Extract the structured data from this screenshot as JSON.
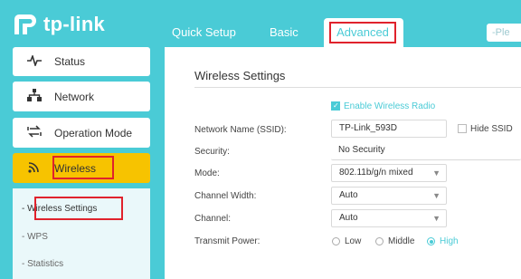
{
  "brand": {
    "logo_text": "tp-link"
  },
  "top_nav": {
    "quick_setup": "Quick Setup",
    "basic": "Basic",
    "advanced": "Advanced",
    "search_placeholder": "-Ple"
  },
  "sidebar": {
    "items": [
      {
        "label": "Status",
        "icon": "pulse-icon"
      },
      {
        "label": "Network",
        "icon": "network-icon"
      },
      {
        "label": "Operation Mode",
        "icon": "swap-icon"
      },
      {
        "label": "Wireless",
        "icon": "wifi-icon"
      }
    ],
    "submenu": [
      {
        "label": "- Wireless Settings"
      },
      {
        "label": "- WPS"
      },
      {
        "label": "- Statistics"
      }
    ]
  },
  "main": {
    "title": "Wireless Settings",
    "enable_radio_label": "Enable Wireless Radio",
    "enable_radio_checked": true,
    "rows": {
      "ssid_label": "Network Name (SSID):",
      "ssid_value": "TP-Link_593D",
      "hide_ssid_label": "Hide SSID",
      "security_label": "Security:",
      "security_value": "No Security",
      "mode_label": "Mode:",
      "mode_value": "802.11b/g/n mixed",
      "channel_width_label": "Channel Width:",
      "channel_width_value": "Auto",
      "channel_label": "Channel:",
      "channel_value": "Auto",
      "transmit_power_label": "Transmit Power:",
      "power_low": "Low",
      "power_middle": "Middle",
      "power_high": "High"
    }
  },
  "colors": {
    "accent": "#4acbd6",
    "highlight": "#f7c300",
    "annotation": "#e0222c"
  }
}
